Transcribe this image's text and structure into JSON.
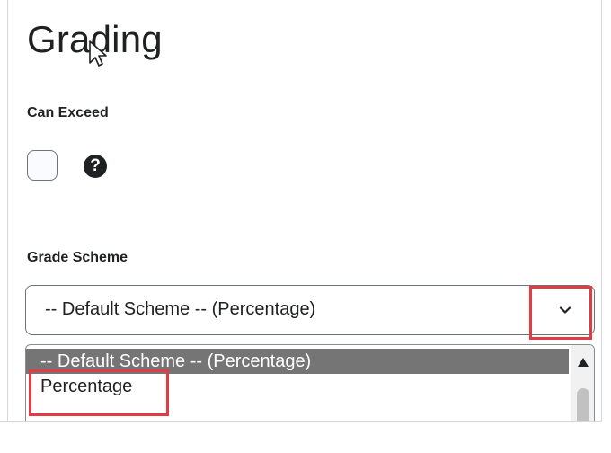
{
  "section": {
    "title": "Grading"
  },
  "can_exceed": {
    "label": "Can Exceed",
    "checked": false,
    "help_icon": "question-circle-icon",
    "help_glyph": "?"
  },
  "grade_scheme": {
    "label": "Grade Scheme",
    "selected": "-- Default Scheme -- (Percentage)",
    "chevron_icon": "chevron-down-icon",
    "options": [
      {
        "label": "-- Default Scheme -- (Percentage)",
        "highlighted": true
      },
      {
        "label": "Percentage",
        "highlighted": false
      }
    ]
  },
  "annotations": {
    "highlight_color": "#e23b43"
  },
  "colors": {
    "text": "#202122",
    "selected_option_bg": "#757575",
    "border": "#6e7376"
  }
}
